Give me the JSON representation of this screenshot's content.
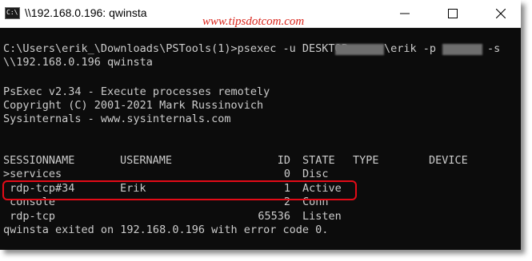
{
  "window": {
    "title": "\\\\192.168.0.196: qwinsta",
    "icon_label": "C:\\",
    "watermark": "www.tipsdotcom.com",
    "controls": {
      "minimize": "minimize-icon",
      "maximize": "maximize-icon",
      "close": "close-icon"
    }
  },
  "terminal": {
    "command_line": "C:\\Users\\erik_\\Downloads\\PSTools(1)>psexec -u DESKTOP-",
    "command_user_part": "\\erik -p",
    "command_flag": "-s",
    "command_continuation": "\\\\192.168.0.196 qwinsta",
    "banner": [
      "PsExec v2.34 - Execute processes remotely",
      "Copyright (C) 2001-2021 Mark Russinovich",
      "Sysinternals - www.sysinternals.com"
    ],
    "table": {
      "headers": {
        "session": "SESSIONNAME",
        "username": "USERNAME",
        "id": "ID",
        "state": "STATE",
        "type": "TYPE",
        "device": "DEVICE"
      },
      "rows": [
        {
          "session": ">services",
          "username": "",
          "id": "0",
          "state": "Disc"
        },
        {
          "session": " rdp-tcp#34",
          "username": "Erik",
          "id": "1",
          "state": "Active"
        },
        {
          "session": " console",
          "username": "",
          "id": "2",
          "state": "Conn"
        },
        {
          "session": " rdp-tcp",
          "username": "",
          "id": "65536",
          "state": "Listen"
        }
      ]
    },
    "exit_message": "qwinsta exited on 192.168.0.196 with error code 0."
  },
  "colors": {
    "terminal_background": "#0c0c0c",
    "terminal_text": "#cccccc",
    "highlight_border": "#e30b17",
    "watermark": "#d9251c"
  }
}
